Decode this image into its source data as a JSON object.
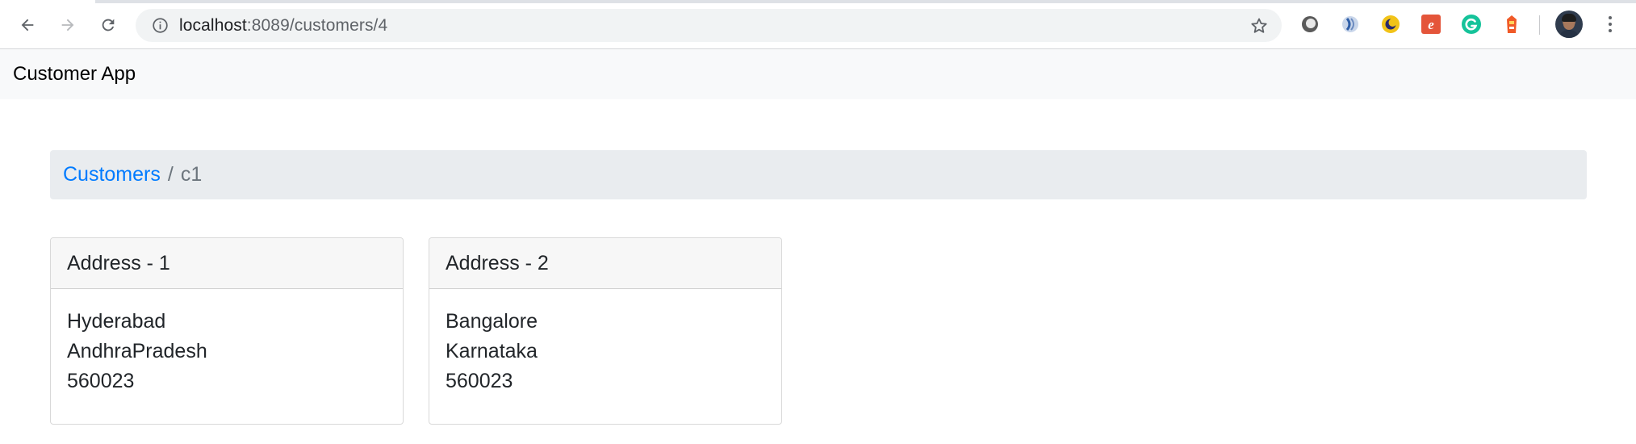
{
  "browser": {
    "url_host": "localhost",
    "url_path": ":8089/customers/4",
    "extensions": [
      "extension-icon-1",
      "extension-icon-2",
      "extension-icon-3",
      "extension-icon-4",
      "grammarly-icon",
      "extension-icon-6"
    ]
  },
  "navbar": {
    "brand": "Customer App"
  },
  "breadcrumb": {
    "link_label": "Customers",
    "separator": "/",
    "current": "c1"
  },
  "addresses": [
    {
      "header": "Address - 1",
      "city": "Hyderabad",
      "state": "AndhraPradesh",
      "zip": "560023"
    },
    {
      "header": "Address - 2",
      "city": "Bangalore",
      "state": "Karnataka",
      "zip": "560023"
    }
  ]
}
